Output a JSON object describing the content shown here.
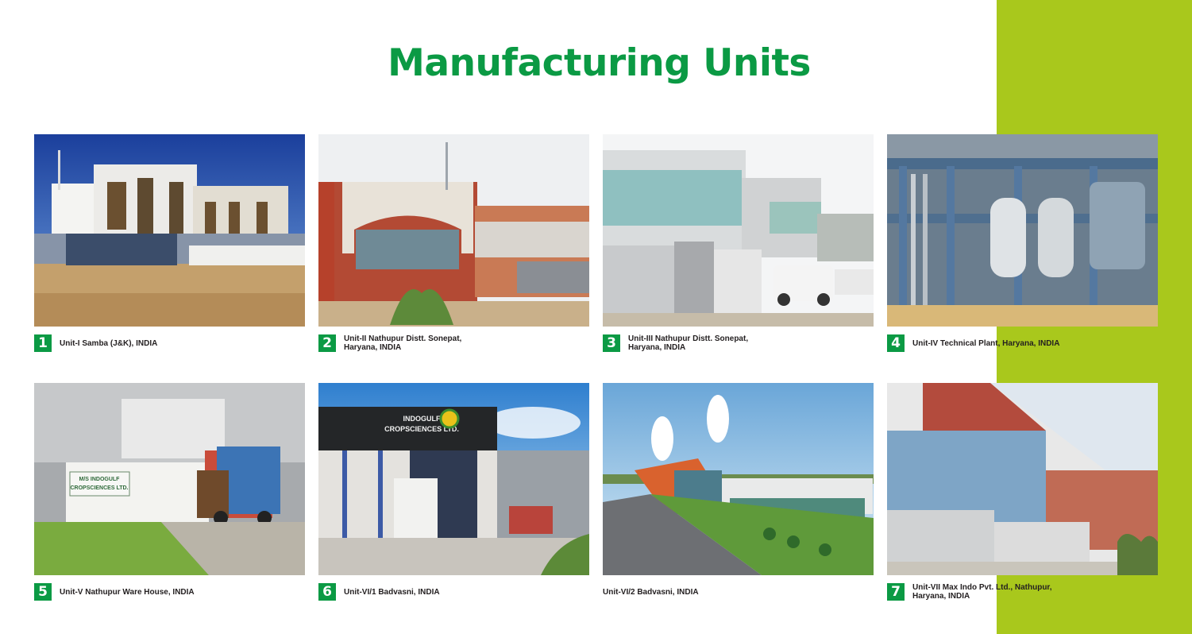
{
  "title": "Manufacturing Units",
  "colors": {
    "title_green": "#0b9a44",
    "badge_green": "#0b9a44",
    "side_band": "#a9c81c"
  },
  "units": [
    {
      "number": "1",
      "caption": "Unit-I Samba (J&K), INDIA"
    },
    {
      "number": "2",
      "caption": "Unit-II Nathupur Distt. Sonepat,\nHaryana, INDIA"
    },
    {
      "number": "3",
      "caption": "Unit-III Nathupur Distt. Sonepat,\nHaryana, INDIA"
    },
    {
      "number": "4",
      "caption": "Unit-IV Technical Plant, Haryana, INDIA"
    },
    {
      "number": "5",
      "caption": "Unit-V Nathupur Ware House, INDIA"
    },
    {
      "number": "6",
      "caption": "Unit-VI/1 Badvasni, INDIA"
    },
    {
      "number": "",
      "caption": "Unit-VI/2 Badvasni, INDIA"
    },
    {
      "number": "7",
      "caption": "Unit-VII Max Indo Pvt. Ltd., Nathupur,\nHaryana, INDIA"
    }
  ],
  "photo_signs": {
    "unit6": [
      "INDOGULF",
      "CROPSCIENCES LTD."
    ],
    "unit5": [
      "M/S INDOGULF",
      "CROPSCIENCES LTD."
    ]
  }
}
